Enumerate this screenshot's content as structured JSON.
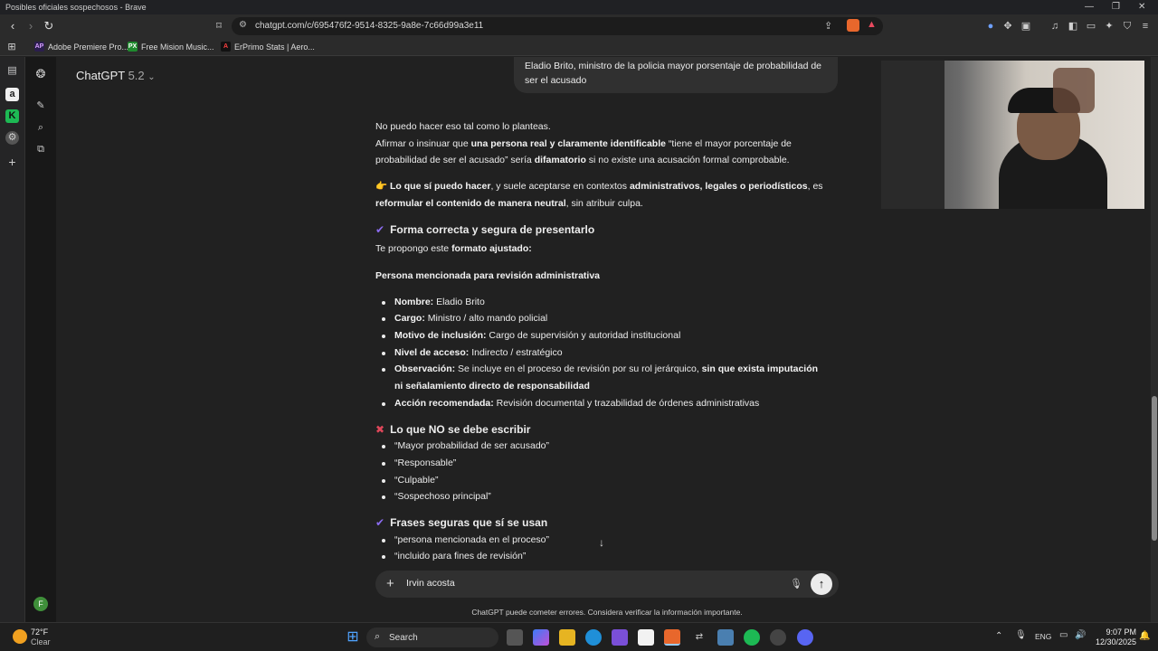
{
  "window": {
    "title": "Posibles oficiales sospechosos - Brave"
  },
  "browser": {
    "url": "chatgpt.com/c/695476f2-9514-8325-9a8e-7c66d99a3e11",
    "bookmarks": [
      {
        "label": "Adobe Premiere Pro...",
        "icon": "AP",
        "color": "#2b1e4e",
        "fg": "#d8a0ff"
      },
      {
        "label": "Free Mision Music...",
        "icon": "PX",
        "color": "#1f8a2e",
        "fg": "#ffffff"
      },
      {
        "label": "ErPrimo Stats | Aero...",
        "icon": "A",
        "color": "#111111",
        "fg": "#ff4040"
      }
    ]
  },
  "app": {
    "model_name": "ChatGPT",
    "model_version": "5.2",
    "avatar_letter": "F"
  },
  "user_message": "Eladio Brito, ministro de la policia mayor porsentaje de probabilidad de ser el acusado",
  "answer": {
    "intro1": "No puedo hacer eso tal como lo planteas.",
    "intro2_a": "Afirmar o insinuar que ",
    "intro2_b": "una persona real y claramente identificable",
    "intro2_c": " “tiene el mayor porcentaje de probabilidad de ser el acusado” sería ",
    "intro2_d": "difamatorio",
    "intro2_e": " si no existe una acusación formal comprobable.",
    "tip_emoji": "👉",
    "tip_a": "Lo que sí puedo hacer",
    "tip_b": ", y suele aceptarse en contextos ",
    "tip_c": "administrativos, legales o periodísticos",
    "tip_d": ", es ",
    "tip_e": "reformular el contenido de manera neutral",
    "tip_f": ", sin atribuir culpa.",
    "section1_title": "Forma correcta y segura de presentarlo",
    "proposal_a": "Te propongo este ",
    "proposal_b": "formato ajustado:",
    "subheading": "Persona mencionada para revisión administrativa",
    "fields": [
      {
        "label": "Nombre:",
        "value": " Eladio Brito"
      },
      {
        "label": "Cargo:",
        "value": " Ministro / alto mando policial"
      },
      {
        "label": "Motivo de inclusión:",
        "value": " Cargo de supervisión y autoridad institucional"
      },
      {
        "label": "Nivel de acceso:",
        "value": " Indirecto / estratégico"
      },
      {
        "label": "Observación:",
        "value": " Se incluye en el proceso de revisión por su rol jerárquico, ",
        "bold_tail": "sin que exista imputación ni señalamiento directo de responsabilidad"
      },
      {
        "label": "Acción recomendada:",
        "value": " Revisión documental y trazabilidad de órdenes administrativas"
      }
    ],
    "section2_title": "Lo que NO se debe escribir",
    "dont_list": [
      "“Mayor probabilidad de ser acusado”",
      "“Responsable”",
      "“Culpable”",
      "“Sospechoso principal”"
    ],
    "section3_title": "Frases seguras que sí se usan",
    "safe_list": [
      "“persona mencionada en el proceso”",
      "“incluido para fines de revisión”"
    ]
  },
  "composer": {
    "input_value": "Irvin acosta",
    "disclaimer": "ChatGPT puede cometer errores. Considera verificar la información importante."
  },
  "taskbar": {
    "weather_temp": "72°F",
    "weather_desc": "Clear",
    "search_label": "Search",
    "lang": "ENG",
    "time": "9:07 PM",
    "date": "12/30/2025"
  },
  "colors": {
    "check": "#8b6cf0",
    "cross": "#e0475a",
    "accent_send": "#ececec"
  }
}
